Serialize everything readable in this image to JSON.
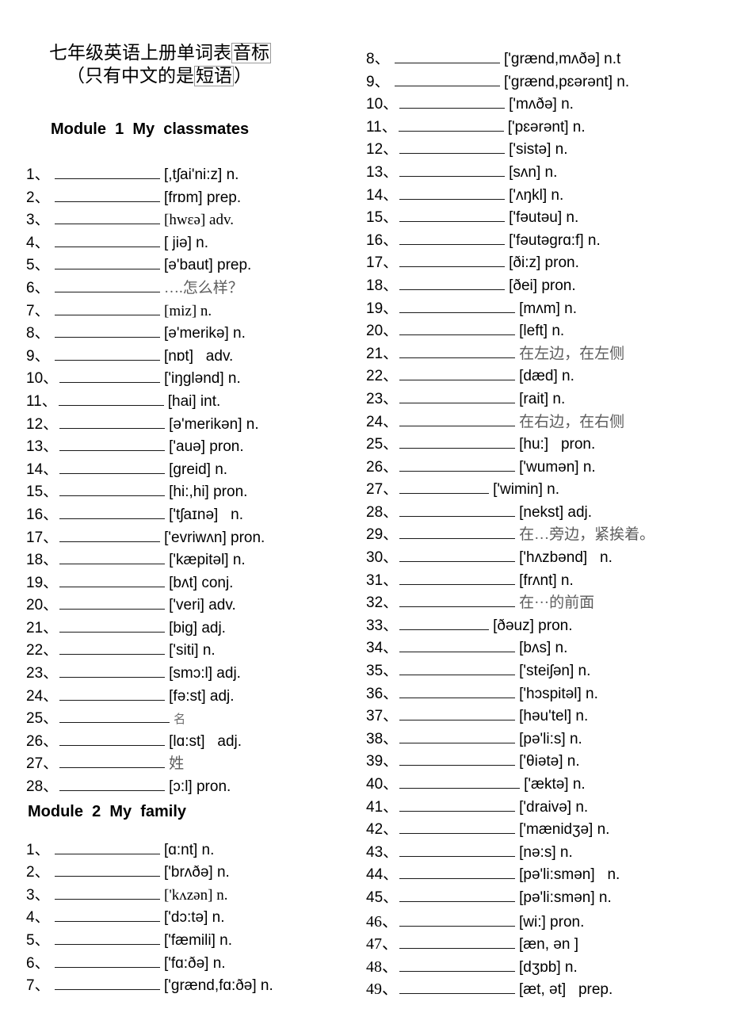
{
  "title": {
    "line1_prefix": "七年级英语上册单词表",
    "line1_boxed": "音标",
    "line2_prefix": "（只有中文的是",
    "line2_boxed": "短语",
    "line2_suffix": "）"
  },
  "modules": [
    {
      "heading": "Module  1  My  classmates"
    },
    {
      "heading": "Module  2  My  family"
    }
  ],
  "columns": {
    "left": [
      {
        "num": "1、",
        "blank_w": 133,
        "text": "[,tʃai'ni:z] n."
      },
      {
        "num": "2、",
        "blank_w": 133,
        "text": "[frɒm] prep."
      },
      {
        "num": "3、",
        "blank_w": 133,
        "text": "[hwɛə] adv.",
        "style": "serif-tag"
      },
      {
        "num": "4、",
        "blank_w": 133,
        "text": "[ jiə] n."
      },
      {
        "num": "5、",
        "blank_w": 133,
        "text": "[ə'baut] prep."
      },
      {
        "num": "6、",
        "blank_w": 133,
        "text": "….怎么样？",
        "style": "cn"
      },
      {
        "num": "7、",
        "blank_w": 133,
        "text": "[miz] n.",
        "style": "serif"
      },
      {
        "num": "8、",
        "blank_w": 133,
        "text": "[ə'merikə] n."
      },
      {
        "num": "9、",
        "blank_w": 133,
        "text": "[nɒt]   adv."
      },
      {
        "num": "10、",
        "blank_w": 127,
        "text": "['iŋglənd] n."
      },
      {
        "num": "11、",
        "blank_w": 133,
        "text": "[hai] int."
      },
      {
        "num": "12、",
        "blank_w": 133,
        "text": "[ə'merikən] n."
      },
      {
        "num": "13、",
        "blank_w": 133,
        "text": "['auə] pron."
      },
      {
        "num": "14、",
        "blank_w": 133,
        "text": "[greid] n."
      },
      {
        "num": "15、",
        "blank_w": 133,
        "text": "[hi:,hi] pron."
      },
      {
        "num": "16、",
        "blank_w": 133,
        "text": "['tʃaɪnə]   n."
      },
      {
        "num": "17、",
        "blank_w": 127,
        "text": "['evriwʌn] pron."
      },
      {
        "num": "18、",
        "blank_w": 133,
        "text": "['kæpitəl] n."
      },
      {
        "num": "19、",
        "blank_w": 133,
        "text": "[bʌt] conj."
      },
      {
        "num": "20、",
        "blank_w": 133,
        "text": "['veri] adv."
      },
      {
        "num": "21、",
        "blank_w": 133,
        "text": "[big] adj."
      },
      {
        "num": "22、",
        "blank_w": 133,
        "text": "['siti] n."
      },
      {
        "num": "23、",
        "blank_w": 133,
        "text": "[smɔ:l] adj."
      },
      {
        "num": "24、",
        "blank_w": 133,
        "text": "[fə:st] adj."
      },
      {
        "num": "25、",
        "blank_w": 139,
        "text": "名",
        "style": "cn-small"
      },
      {
        "num": "26、",
        "blank_w": 133,
        "text": "[lɑ:st]   adj."
      },
      {
        "num": "27、",
        "blank_w": 133,
        "text": "姓",
        "style": "cn"
      },
      {
        "num": "28、",
        "blank_w": 133,
        "text": "[ɔ:l] pron."
      }
    ],
    "left_module2": [
      {
        "num": "1、",
        "blank_w": 133,
        "text": "[ɑ:nt] n."
      },
      {
        "num": "2、",
        "blank_w": 133,
        "text": "['brʌðə] n."
      },
      {
        "num": "3、",
        "blank_w": 133,
        "text": "['kʌzən] n.",
        "style": "serif-tag"
      },
      {
        "num": "4、",
        "blank_w": 133,
        "text": "['dɔ:tə] n."
      },
      {
        "num": "5、",
        "blank_w": 133,
        "text": "['fæmili] n."
      },
      {
        "num": "6、",
        "blank_w": 133,
        "text": "['fɑ:ðə] n."
      },
      {
        "num": "7、",
        "blank_w": 133,
        "text": "['grænd,fɑ:ðə] n."
      }
    ],
    "right": [
      {
        "num": "8、",
        "blank_w": 133,
        "text": "['grænd,mʌðə] n.t"
      },
      {
        "num": "9、",
        "blank_w": 133,
        "text": "['grænd,pɛərənt] n."
      },
      {
        "num": "10、",
        "blank_w": 133,
        "text": "['mʌðə] n."
      },
      {
        "num": "11、",
        "blank_w": 133,
        "text": "['pɛərənt] n."
      },
      {
        "num": "12、",
        "blank_w": 133,
        "text": "['sistə] n."
      },
      {
        "num": "13、",
        "blank_w": 133,
        "text": "[sʌn] n."
      },
      {
        "num": "14、",
        "blank_w": 133,
        "text": "['ʌŋkl] n."
      },
      {
        "num": "15、",
        "blank_w": 133,
        "text": "['fəutəu] n."
      },
      {
        "num": "16、",
        "blank_w": 133,
        "text": "['fəutəgrɑ:f] n."
      },
      {
        "num": "17、",
        "blank_w": 133,
        "text": "[ði:z] pron."
      },
      {
        "num": "18、",
        "blank_w": 133,
        "text": "[ðei] pron."
      },
      {
        "num": "19、",
        "blank_w": 146,
        "text": "[mʌm] n."
      },
      {
        "num": "20、",
        "blank_w": 146,
        "text": "[left] n."
      },
      {
        "num": "21、",
        "blank_w": 146,
        "text": "在左边，在左侧",
        "style": "cn"
      },
      {
        "num": "22、",
        "blank_w": 146,
        "text": "[dæd] n."
      },
      {
        "num": "23、",
        "blank_w": 146,
        "text": "[rait] n."
      },
      {
        "num": "24、",
        "blank_w": 146,
        "text": "在右边，在右侧",
        "style": "cn"
      },
      {
        "num": "25、",
        "blank_w": 146,
        "text": "[hu:]   pron."
      },
      {
        "num": "26、",
        "blank_w": 146,
        "text": "['wumən] n."
      },
      {
        "num": "27、",
        "blank_w": 113,
        "text": "['wimin] n."
      },
      {
        "num": "28、",
        "blank_w": 146,
        "text": "[nekst] adj."
      },
      {
        "num": "29、",
        "blank_w": 146,
        "text": "在…旁边，紧挨着。",
        "style": "cn"
      },
      {
        "num": "30、",
        "blank_w": 146,
        "text": "['hʌzbənd]   n."
      },
      {
        "num": "31、",
        "blank_w": 146,
        "text": "[frʌnt] n."
      },
      {
        "num": "32、",
        "blank_w": 146,
        "text": "在···的前面",
        "style": "cn"
      },
      {
        "num": "33、",
        "blank_w": 113,
        "text": "[ðəuz] pron."
      },
      {
        "num": "34、",
        "blank_w": 146,
        "text": "[bʌs] n."
      },
      {
        "num": "35、",
        "blank_w": 146,
        "text": "['steiʃən] n."
      },
      {
        "num": "36、",
        "blank_w": 146,
        "text": "['hɔspitəl] n."
      },
      {
        "num": "37、",
        "blank_w": 146,
        "text": "[həu'tel] n."
      },
      {
        "num": "38、",
        "blank_w": 146,
        "text": "[pə'li:s] n."
      },
      {
        "num": "39、",
        "blank_w": 146,
        "text": "['θiətə] n."
      },
      {
        "num": "40、",
        "blank_w": 152,
        "text": "['æktə] n."
      },
      {
        "num": "41、",
        "blank_w": 146,
        "text": "['draivə] n."
      },
      {
        "num": "42、",
        "blank_w": 146,
        "text": "['mænidʒə] n."
      },
      {
        "num": "43、",
        "blank_w": 146,
        "text": "[nə:s] n."
      },
      {
        "num": "44、",
        "blank_w": 146,
        "text": "[pə'li:smən]   n."
      },
      {
        "num": "45、",
        "blank_w": 146,
        "text": "[pə'li:smən] n."
      },
      {
        "num": "46、",
        "blank_w": 146,
        "text": "[wi:] pron.",
        "num_style": "serif"
      },
      {
        "num": "47、",
        "blank_w": 146,
        "text": "[æn, ən ]",
        "num_style": "serif"
      },
      {
        "num": "48、",
        "blank_w": 146,
        "text": "[dʒɒb] n.",
        "num_style": "serif"
      },
      {
        "num": "49、",
        "blank_w": 146,
        "text": "[æt, ət]   prep.",
        "num_style": "serif"
      }
    ]
  }
}
